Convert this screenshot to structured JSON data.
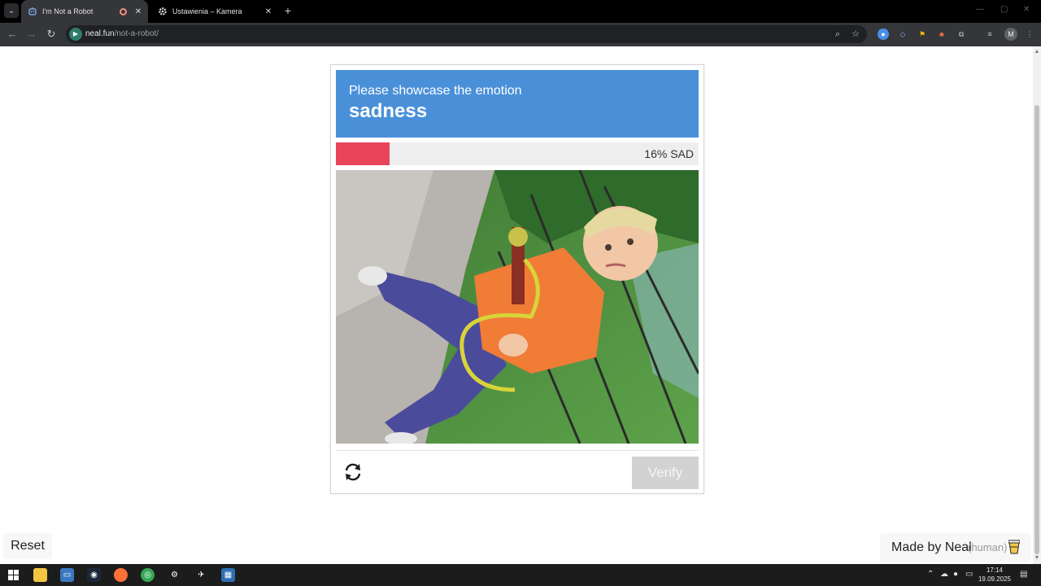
{
  "browser": {
    "tabs": [
      {
        "title": "I'm Not a Robot",
        "active": true,
        "recording": true
      },
      {
        "title": "Ustawienia – Kamera",
        "active": false
      }
    ],
    "url_host": "neal.fun",
    "url_path": "/not-a-robot/",
    "profile_initial": "M"
  },
  "captcha": {
    "prompt_line1": "Please showcase the emotion",
    "prompt_emotion": "sadness",
    "meter_percent": 16,
    "meter_label": "16% SAD",
    "verify_label": "Verify",
    "colors": {
      "header": "#4a90d9",
      "meter_fill": "#e8445a",
      "verify_disabled": "#d2d2d2"
    }
  },
  "footer": {
    "reset_label": "Reset",
    "made_by": "Made by Neal",
    "human_tag": "(human)"
  },
  "taskbar": {
    "time": "17:14",
    "date": "19.09.2025"
  }
}
